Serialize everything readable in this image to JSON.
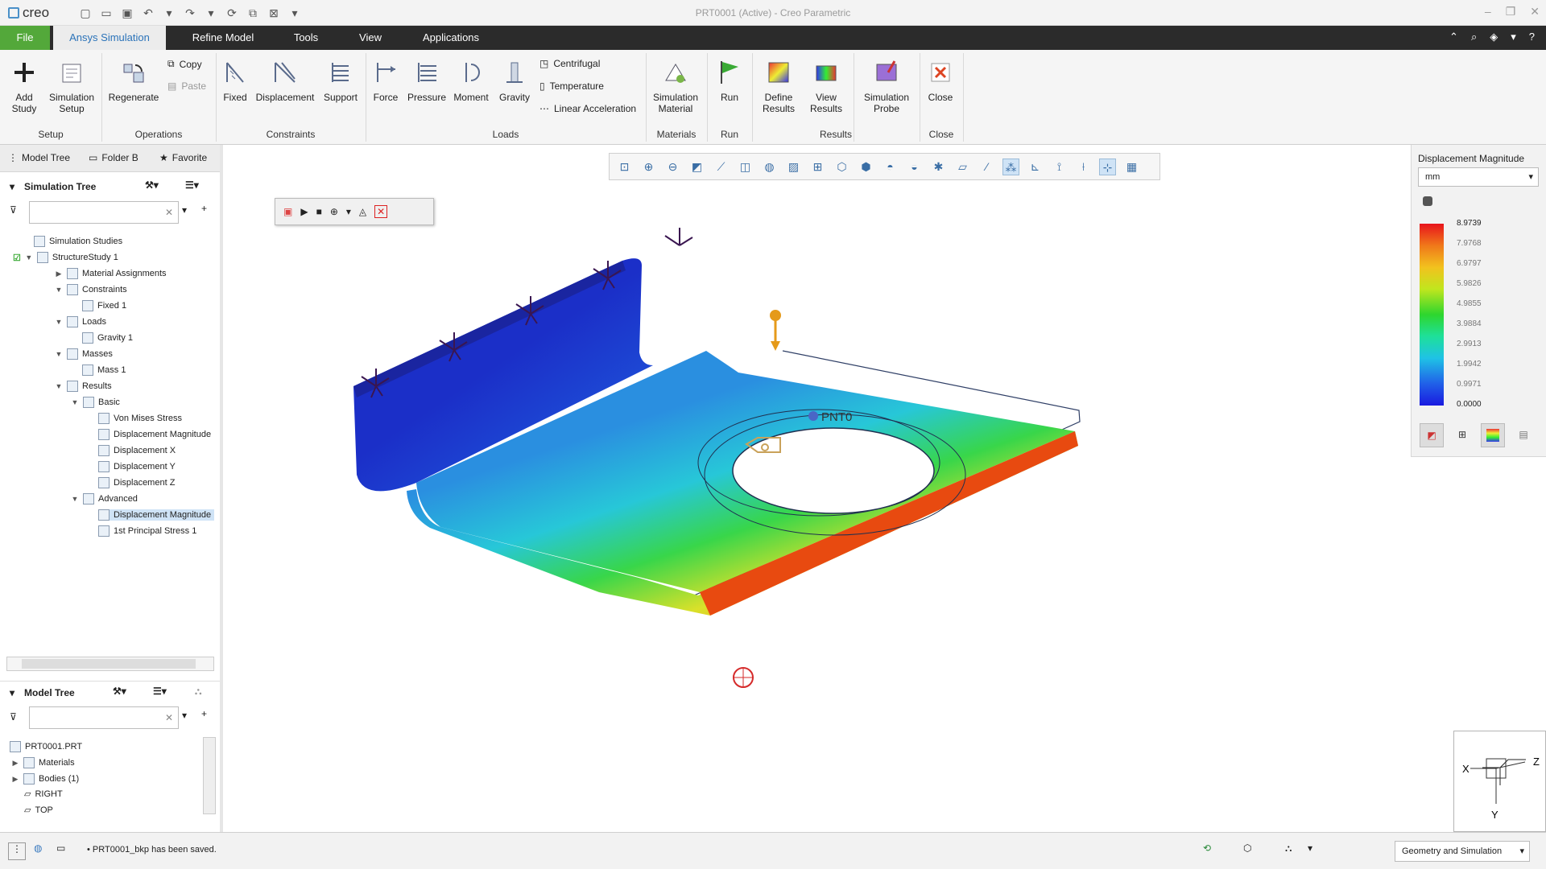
{
  "app": {
    "logo": "creo",
    "window_title": "PRT0001 (Active) - Creo Parametric"
  },
  "menubar": {
    "tabs": [
      "File",
      "Ansys Simulation",
      "Refine Model",
      "Tools",
      "View",
      "Applications"
    ]
  },
  "ribbon": {
    "buttons": {
      "add_study": "Add Study",
      "simulation_setup": "Simulation Setup",
      "regenerate": "Regenerate",
      "copy": "Copy",
      "paste": "Paste",
      "fixed": "Fixed",
      "displacement": "Displacement",
      "support": "Support",
      "force": "Force",
      "pressure": "Pressure",
      "moment": "Moment",
      "gravity": "Gravity",
      "centrifugal": "Centrifugal",
      "temperature": "Temperature",
      "linear_acceleration": "Linear Acceleration",
      "simulation_material": "Simulation Material",
      "run": "Run",
      "define_results": "Define Results",
      "view_results": "View Results",
      "simulation_probe": "Simulation Probe",
      "close": "Close"
    },
    "groups": {
      "setup": "Setup",
      "operations": "Operations",
      "constraints": "Constraints",
      "loads": "Loads",
      "materials": "Materials",
      "run": "Run",
      "results": "Results",
      "close": "Close"
    }
  },
  "leftpanel": {
    "tabs": [
      "Model Tree",
      "Folder B",
      "Favorite"
    ],
    "sim_tree_title": "Simulation Tree",
    "sim_tree": [
      "Simulation Studies",
      "StructureStudy 1",
      "Material Assignments",
      "Constraints",
      "Fixed 1",
      "Loads",
      "Gravity 1",
      "Masses",
      "Mass 1",
      "Results",
      "Basic",
      "Von Mises Stress",
      "Displacement Magnitude",
      "Displacement X",
      "Displacement Y",
      "Displacement Z",
      "Advanced",
      "Displacement Magnitude",
      "1st Principal Stress 1"
    ],
    "model_tree_title": "Model Tree",
    "model_tree": [
      "PRT0001.PRT",
      "Materials",
      "Bodies (1)",
      "RIGHT",
      "TOP"
    ]
  },
  "viewport": {
    "point_label": "PNT0"
  },
  "legend": {
    "title": "Displacement Magnitude",
    "unit": "mm",
    "values": [
      "8.9739",
      "7.9768",
      "6.9797",
      "5.9826",
      "4.9855",
      "3.9884",
      "2.9913",
      "1.9942",
      "0.9971",
      "0.0000"
    ]
  },
  "triad": {
    "x": "X",
    "y": "Y",
    "z": "Z"
  },
  "status": {
    "message": "PRT0001_bkp has been saved.",
    "filter": "Geometry and Simulation"
  }
}
